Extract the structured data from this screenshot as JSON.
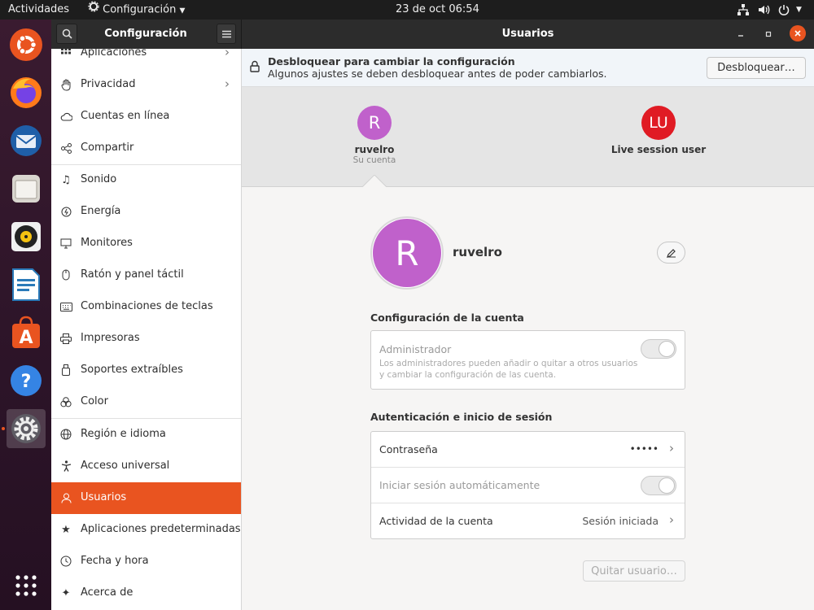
{
  "topbar": {
    "activities": "Actividades",
    "app_menu": "Configuración",
    "clock": "23 de oct  06:54"
  },
  "dock": {
    "apps": [
      {
        "name": "ubuntu-icon"
      },
      {
        "name": "firefox-icon"
      },
      {
        "name": "thunderbird-icon"
      },
      {
        "name": "files-icon"
      },
      {
        "name": "rhythmbox-icon"
      },
      {
        "name": "writer-icon"
      },
      {
        "name": "software-icon"
      },
      {
        "name": "help-icon"
      },
      {
        "name": "settings-icon"
      }
    ]
  },
  "header": {
    "sidebar_title": "Configuración",
    "page_title": "Usuarios"
  },
  "sidebar": {
    "items": [
      {
        "label": "Aplicaciones"
      },
      {
        "label": "Privacidad"
      },
      {
        "label": "Cuentas en línea"
      },
      {
        "label": "Compartir"
      },
      {
        "label": "Sonido"
      },
      {
        "label": "Energía"
      },
      {
        "label": "Monitores"
      },
      {
        "label": "Ratón y panel táctil"
      },
      {
        "label": "Combinaciones de teclas"
      },
      {
        "label": "Impresoras"
      },
      {
        "label": "Soportes extraíbles"
      },
      {
        "label": "Color"
      },
      {
        "label": "Región e idioma"
      },
      {
        "label": "Acceso universal"
      },
      {
        "label": "Usuarios"
      },
      {
        "label": "Aplicaciones predeterminadas"
      },
      {
        "label": "Fecha y hora"
      },
      {
        "label": "Acerca de"
      }
    ]
  },
  "infobar": {
    "title": "Desbloquear para cambiar la configuración",
    "subtitle": "Algunos ajustes se deben desbloquear antes de poder cambiarlos.",
    "unlock_button": "Desbloquear…"
  },
  "users": [
    {
      "initial": "R",
      "name": "ruvelro",
      "caption": "Su cuenta",
      "color": "#c061cb"
    },
    {
      "initial": "LU",
      "name": "Live session user",
      "caption": "",
      "color": "#e01b24"
    }
  ],
  "profile": {
    "initial": "R",
    "name": "ruvelro",
    "color": "#c061cb"
  },
  "account_section": {
    "heading": "Configuración de la cuenta",
    "admin_label": "Administrador",
    "admin_desc_1": "Los administradores pueden añadir o quitar a otros usuarios",
    "admin_desc_2": "y cambiar la configuración de las cuenta."
  },
  "auth_section": {
    "heading": "Autenticación e inicio de sesión",
    "password_label": "Contraseña",
    "password_value": "•••••",
    "autologin_label": "Iniciar sesión automáticamente",
    "activity_label": "Actividad de la cuenta",
    "activity_value": "Sesión iniciada"
  },
  "remove_user_button": "Quitar usuario…",
  "colors": {
    "accent": "#e95420",
    "header": "#2c2c2c",
    "topbar": "#1d1d1d"
  }
}
